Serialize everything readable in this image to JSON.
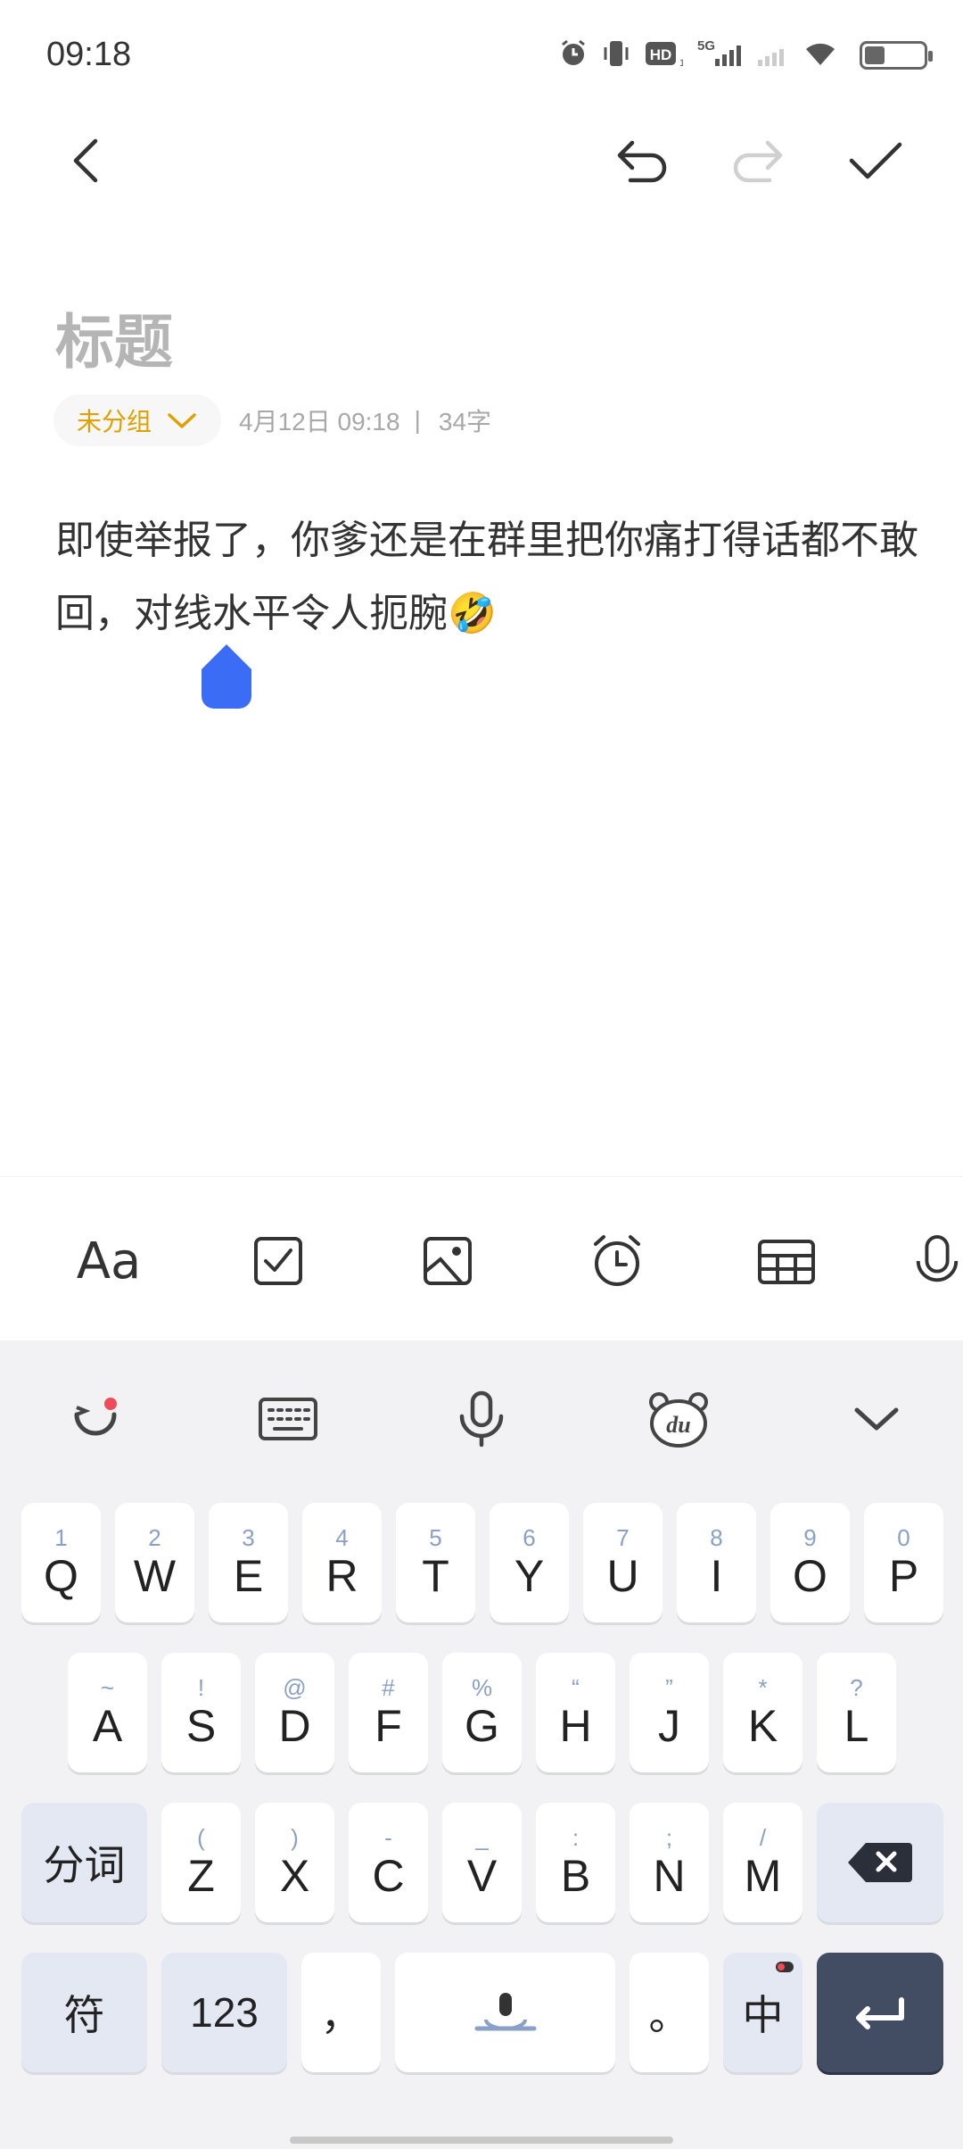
{
  "status_bar": {
    "time": "09:18",
    "network": "5G",
    "hd_label": "HD",
    "battery_level": "5",
    "icons": [
      "alarm-icon",
      "vibrate-icon",
      "hd-icon",
      "signal-5g-icon",
      "signal-icon",
      "wifi-icon",
      "battery-icon"
    ]
  },
  "toolbar": {
    "back_icon": "back-arrow-icon",
    "undo_icon": "undo-icon",
    "redo_icon": "redo-icon",
    "done_icon": "check-icon"
  },
  "note": {
    "title_placeholder": "标题",
    "group_label": "未分组",
    "date": "4月12日 09:18",
    "separator": "|",
    "word_count": "34字",
    "body": "即使举报了，你爹还是在群里把你痛打得话都不敢回，对线水平令人扼腕🤣"
  },
  "editor_toolbar": {
    "font_label": "Aa",
    "items": [
      "font-style-icon",
      "checklist-icon",
      "image-icon",
      "alarm-icon",
      "table-icon",
      "microphone-icon"
    ]
  },
  "keyboard": {
    "top_tools": [
      "emoji-icon",
      "keyboard-icon",
      "voice-icon",
      "du-bear-icon",
      "collapse-icon"
    ],
    "row1": [
      {
        "num": "1",
        "key": "Q"
      },
      {
        "num": "2",
        "key": "W"
      },
      {
        "num": "3",
        "key": "E"
      },
      {
        "num": "4",
        "key": "R"
      },
      {
        "num": "5",
        "key": "T"
      },
      {
        "num": "6",
        "key": "Y"
      },
      {
        "num": "7",
        "key": "U"
      },
      {
        "num": "8",
        "key": "I"
      },
      {
        "num": "9",
        "key": "O"
      },
      {
        "num": "0",
        "key": "P"
      }
    ],
    "row2": [
      {
        "sym": "~",
        "key": "A"
      },
      {
        "sym": "!",
        "key": "S"
      },
      {
        "sym": "@",
        "key": "D"
      },
      {
        "sym": "#",
        "key": "F"
      },
      {
        "sym": "%",
        "key": "G"
      },
      {
        "sym": "“",
        "key": "H"
      },
      {
        "sym": "”",
        "key": "J"
      },
      {
        "sym": "*",
        "key": "K"
      },
      {
        "sym": "?",
        "key": "L"
      }
    ],
    "row3": [
      {
        "sym": "(",
        "key": "Z"
      },
      {
        "sym": ")",
        "key": "X"
      },
      {
        "sym": "-",
        "key": "C"
      },
      {
        "sym": "_",
        "key": "V"
      },
      {
        "sym": ":",
        "key": "B"
      },
      {
        "sym": ";",
        "key": "N"
      },
      {
        "sym": "/",
        "key": "M"
      }
    ],
    "segment_label": "分词",
    "symbol_label": "符",
    "num_label": "123",
    "comma": "，",
    "period": "。",
    "lang_label": "中"
  }
}
